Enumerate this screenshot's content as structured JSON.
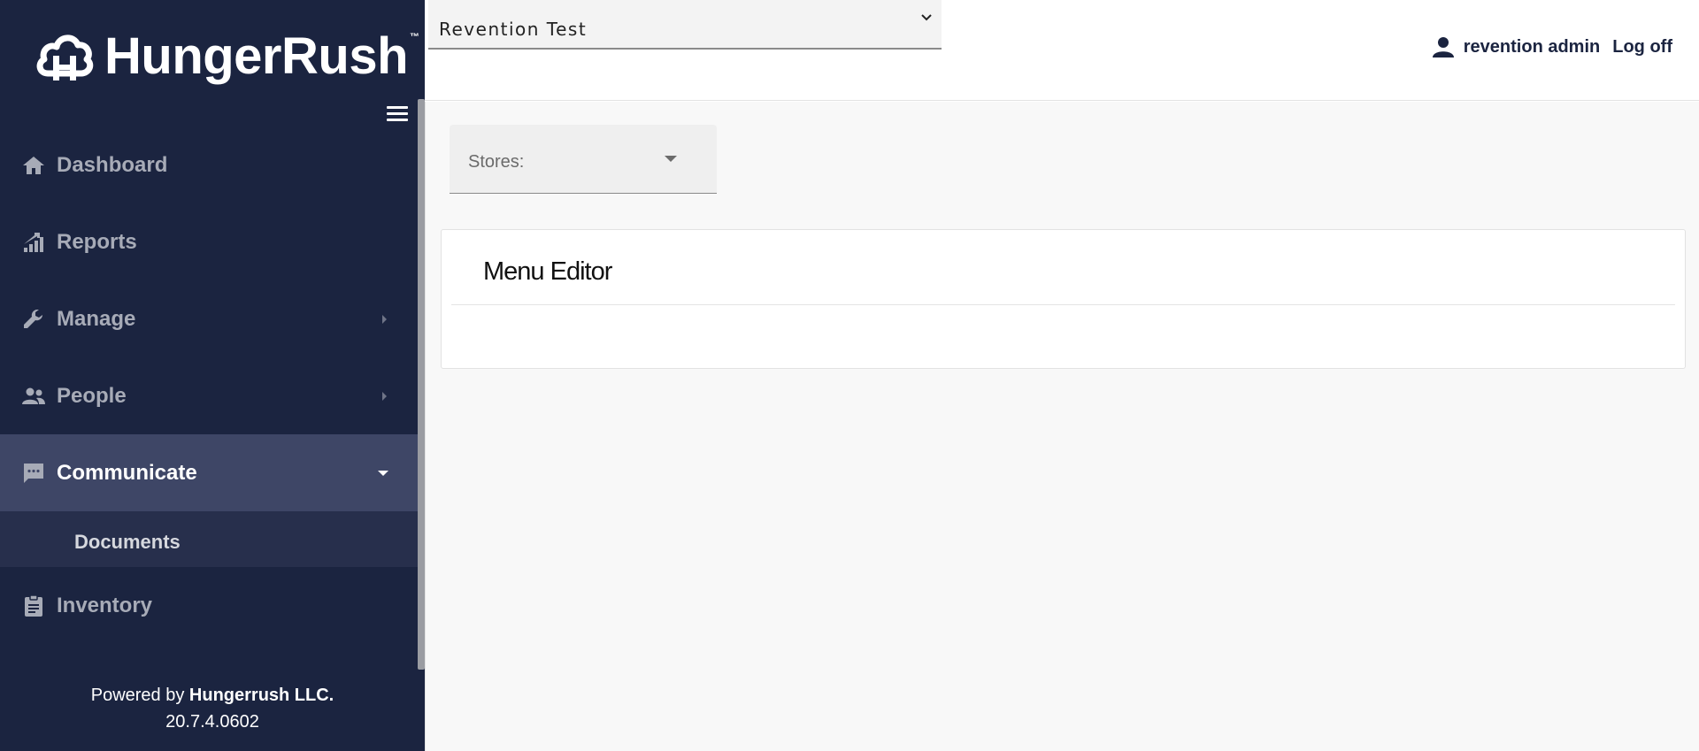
{
  "brand": {
    "name": "HungerRush",
    "tm": "™"
  },
  "sidebar": {
    "items": [
      {
        "label": "Dashboard",
        "icon": "home-icon"
      },
      {
        "label": "Reports",
        "icon": "chart-icon"
      },
      {
        "label": "Manage",
        "icon": "wrench-icon"
      },
      {
        "label": "People",
        "icon": "people-icon"
      },
      {
        "label": "Communicate",
        "icon": "message-icon",
        "active": true
      },
      {
        "label": "Inventory",
        "icon": "clipboard-icon"
      }
    ],
    "subitems": [
      {
        "label": "Documents"
      }
    ]
  },
  "footer": {
    "powered_prefix": "Powered by ",
    "company": "Hungerrush LLC.",
    "version": "20.7.4.0602"
  },
  "header": {
    "company_select": "Revention Test",
    "user_name": "revention admin",
    "logoff": "Log off"
  },
  "main": {
    "stores_label": "Stores:",
    "card_title": "Menu Editor"
  },
  "colors": {
    "sidebar_bg": "#1b2440",
    "sidebar_active": "#3e4666",
    "sidebar_sub": "#272f4c",
    "content_bg": "#f8f8f8"
  }
}
